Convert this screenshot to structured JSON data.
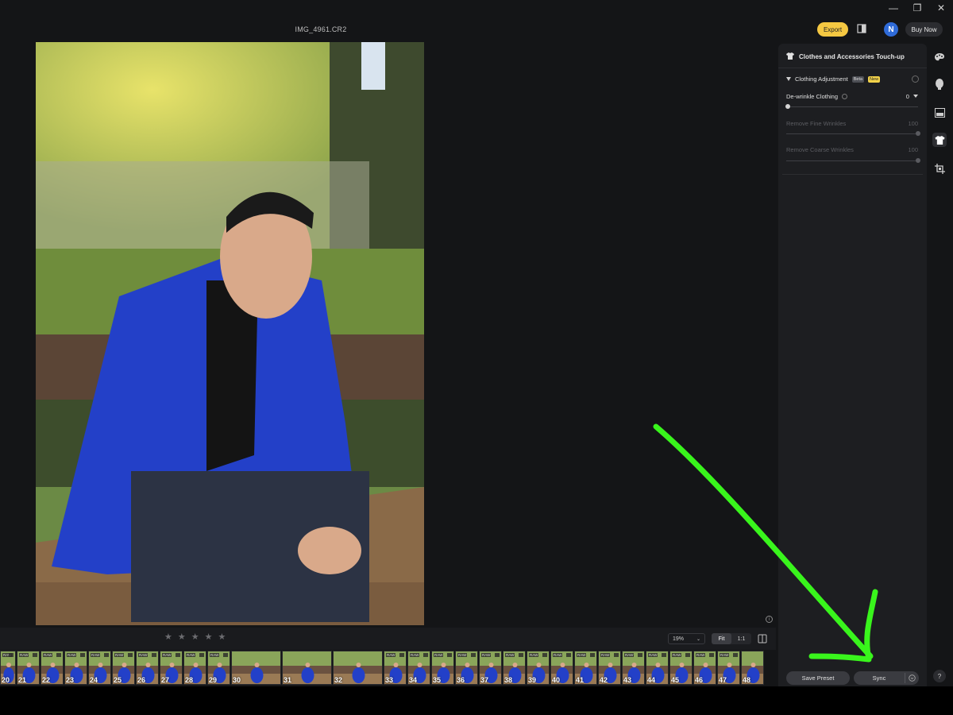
{
  "window": {
    "minimize": "—",
    "restore": "❐",
    "close": "✕"
  },
  "file_name": "IMG_4961.CR2",
  "toolbar": {
    "export_label": "Export",
    "avatar_initial": "N",
    "buy_now_label": "Buy Now"
  },
  "panel": {
    "title": "Clothes and Accessories Touch-up",
    "section": {
      "title": "Clothing Adjustment",
      "badge_beta": "Beta",
      "badge_new": "New",
      "mode_label": "De-wrinkle Clothing",
      "mode_value": "0",
      "sliders": [
        {
          "label": "Remove Fine Wrinkles",
          "value": "100",
          "level": 1.0,
          "disabled": true
        },
        {
          "label": "Remove Coarse Wrinkles",
          "value": "100",
          "level": 1.0,
          "disabled": true
        }
      ]
    },
    "save_preset_label": "Save Preset",
    "sync_label": "Sync"
  },
  "rail_icons": [
    "palette-icon",
    "face-icon",
    "background-icon",
    "shirt-icon",
    "crop-icon"
  ],
  "help_label": "?",
  "bottom": {
    "stars": [
      "★",
      "★",
      "★",
      "★",
      "★"
    ],
    "zoom_value": "19%",
    "zoom_fit": "Fit",
    "zoom_1to1": "1:1"
  },
  "filmstrip": [
    {
      "num": "20",
      "raw": "RAW"
    },
    {
      "num": "21",
      "raw": "RAW"
    },
    {
      "num": "22",
      "raw": "RAW"
    },
    {
      "num": "23",
      "raw": "RAW"
    },
    {
      "num": "24",
      "raw": "RAW"
    },
    {
      "num": "25",
      "raw": "RAW"
    },
    {
      "num": "26",
      "raw": "RAW"
    },
    {
      "num": "27",
      "raw": "RAW"
    },
    {
      "num": "28",
      "raw": "RAW"
    },
    {
      "num": "29",
      "raw": "RAW"
    },
    {
      "num": "30",
      "raw": "",
      "wide": true
    },
    {
      "num": "31",
      "raw": "",
      "wide": true
    },
    {
      "num": "32",
      "raw": "",
      "wide": true
    },
    {
      "num": "33",
      "raw": "RAW"
    },
    {
      "num": "34",
      "raw": "RAW"
    },
    {
      "num": "35",
      "raw": "RAW"
    },
    {
      "num": "36",
      "raw": "RAW"
    },
    {
      "num": "37",
      "raw": "RAW"
    },
    {
      "num": "38",
      "raw": "RAW"
    },
    {
      "num": "39",
      "raw": "RAW"
    },
    {
      "num": "40",
      "raw": "RAW"
    },
    {
      "num": "41",
      "raw": "RAW"
    },
    {
      "num": "42",
      "raw": "RAW"
    },
    {
      "num": "43",
      "raw": "RAW"
    },
    {
      "num": "44",
      "raw": "RAW"
    },
    {
      "num": "45",
      "raw": "RAW"
    },
    {
      "num": "46",
      "raw": "RAW"
    },
    {
      "num": "47",
      "raw": "RAW"
    },
    {
      "num": "48",
      "raw": ""
    }
  ],
  "colors": {
    "accent": "#f5c842",
    "annotation_arrow": "#39f51c",
    "jacket": "#2340c8"
  }
}
